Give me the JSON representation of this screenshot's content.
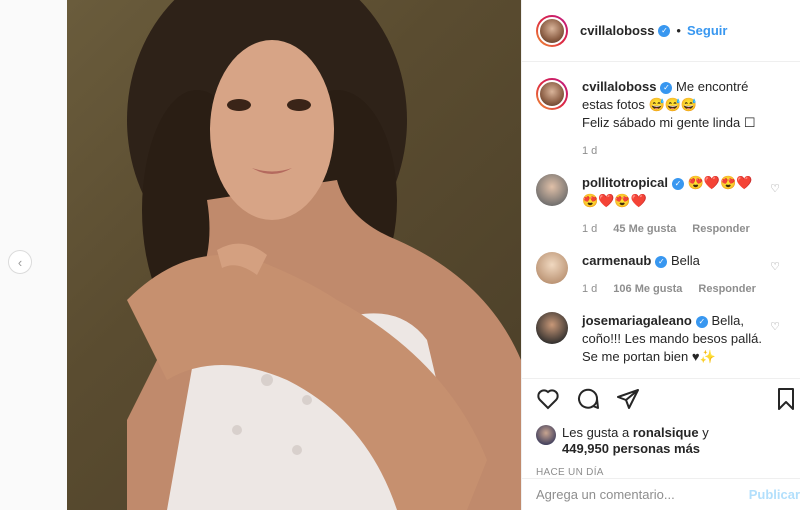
{
  "post": {
    "username": "cvillaloboss",
    "verified_mark": "✓",
    "dot": "•",
    "follow_label": "Seguir",
    "caption_line1": "Me encontré estas fotos 😅😅😅",
    "caption_line2": "Feliz sábado mi gente linda ☐",
    "caption_time": "1 d"
  },
  "comments": [
    {
      "user": "pollitotropical",
      "text": "😍❤️😍❤️😍❤️😍❤️",
      "time": "1 d",
      "likes": "45 Me gusta",
      "reply": "Responder"
    },
    {
      "user": "carmenaub",
      "text": "Bella",
      "time": "1 d",
      "likes": "106 Me gusta",
      "reply": "Responder"
    },
    {
      "user": "josemariagaleano",
      "text": "Bella, coño!!! Les mando besos pallá. Se me portan bien ♥✨",
      "time": "",
      "likes": "",
      "reply": ""
    }
  ],
  "likes": {
    "prefix": "Les gusta a",
    "user": "ronalsique",
    "suffix": "y",
    "count": "449,950 personas más"
  },
  "time_ago": "HACE UN DÍA",
  "add_comment": {
    "placeholder": "Agrega un comentario...",
    "publish": "Publicar"
  },
  "icons": {
    "prev": "‹",
    "heart": "♡"
  }
}
